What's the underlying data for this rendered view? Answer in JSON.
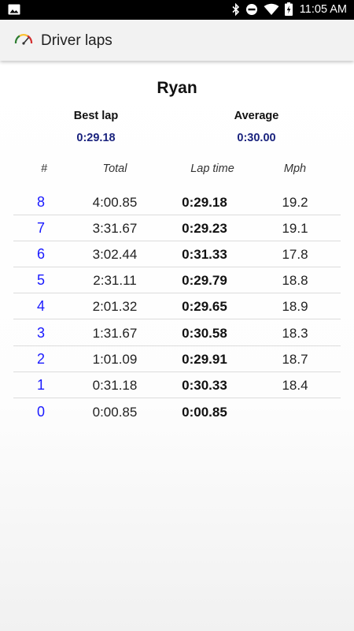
{
  "status_bar": {
    "time": "11:05 AM",
    "icons": [
      "image-icon",
      "bluetooth-icon",
      "do-not-disturb-icon",
      "wifi-icon",
      "battery-charging-icon"
    ]
  },
  "app_bar": {
    "title": "Driver laps",
    "icon": "speedometer-icon"
  },
  "driver": {
    "name": "Ryan",
    "best_lap_label": "Best lap",
    "best_lap_value": "0:29.18",
    "average_label": "Average",
    "average_value": "0:30.00"
  },
  "table": {
    "headers": {
      "num": "#",
      "total": "Total",
      "lap_time": "Lap time",
      "mph": "Mph"
    },
    "rows": [
      {
        "num": "8",
        "total": "4:00.85",
        "lap_time": "0:29.18",
        "mph": "19.2"
      },
      {
        "num": "7",
        "total": "3:31.67",
        "lap_time": "0:29.23",
        "mph": "19.1"
      },
      {
        "num": "6",
        "total": "3:02.44",
        "lap_time": "0:31.33",
        "mph": "17.8"
      },
      {
        "num": "5",
        "total": "2:31.11",
        "lap_time": "0:29.79",
        "mph": "18.8"
      },
      {
        "num": "4",
        "total": "2:01.32",
        "lap_time": "0:29.65",
        "mph": "18.9"
      },
      {
        "num": "3",
        "total": "1:31.67",
        "lap_time": "0:30.58",
        "mph": "18.3"
      },
      {
        "num": "2",
        "total": "1:01.09",
        "lap_time": "0:29.91",
        "mph": "18.7"
      },
      {
        "num": "1",
        "total": "0:31.18",
        "lap_time": "0:30.33",
        "mph": "18.4"
      },
      {
        "num": "0",
        "total": "0:00.85",
        "lap_time": "0:00.85",
        "mph": ""
      }
    ]
  },
  "colors": {
    "accent_blue": "#1a1aff",
    "stat_value": "#1a237e",
    "status_bar": "#000000",
    "app_bar": "#f2f2f2"
  }
}
